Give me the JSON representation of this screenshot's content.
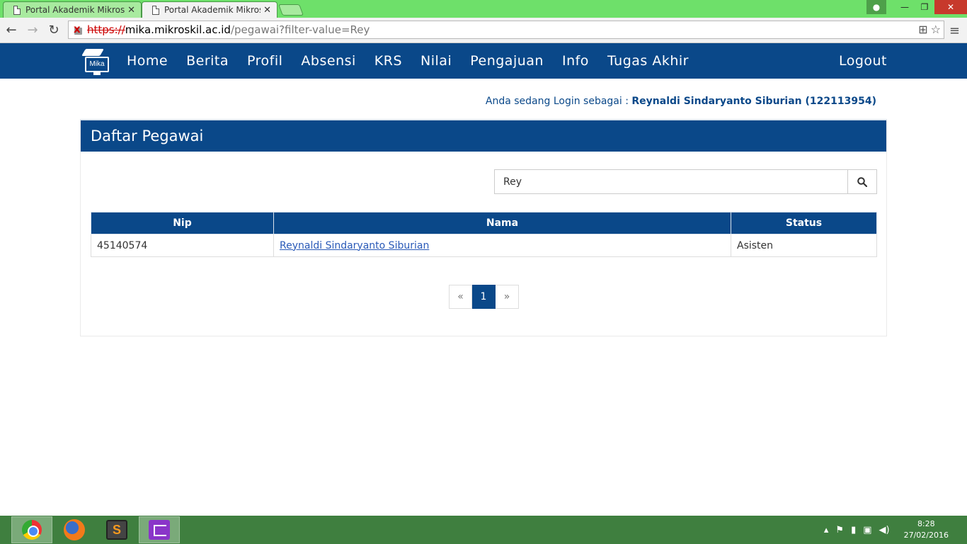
{
  "browser": {
    "tabs": [
      {
        "title": "Portal Akademik Mikroskil",
        "active": false
      },
      {
        "title": "Portal Akademik Mikroskil",
        "active": true
      }
    ],
    "url": {
      "scheme": "https://",
      "host": "mika.mikroskil.ac.id",
      "path": "/pegawai?filter-value=Rey"
    }
  },
  "site": {
    "logo_text": "Mika",
    "nav": [
      "Home",
      "Berita",
      "Profil",
      "Absensi",
      "KRS",
      "Nilai",
      "Pengajuan",
      "Info",
      "Tugas Akhir"
    ],
    "logout": "Logout",
    "login_prefix": "Anda sedang Login sebagai :",
    "login_user": "Reynaldi Sindaryanto Siburian (122113954)"
  },
  "panel": {
    "title": "Daftar Pegawai",
    "search_value": "Rey",
    "table": {
      "headers": [
        "Nip",
        "Nama",
        "Status"
      ],
      "rows": [
        {
          "nip": "45140574",
          "nama": "Reynaldi Sindaryanto Siburian",
          "status": "Asisten"
        }
      ]
    },
    "pagination": {
      "prev": "«",
      "current": "1",
      "next": "»"
    }
  },
  "taskbar": {
    "apps": [
      "chrome-icon",
      "firefox-icon",
      "sublime-icon",
      "visual-studio-icon"
    ],
    "sublime_glyph": "S",
    "clock_time": "8:28",
    "clock_date": "27/02/2016"
  },
  "colors": {
    "brand": "#0a4889",
    "tabstrip": "#6ee06a",
    "taskbar": "#3f7f3f"
  }
}
